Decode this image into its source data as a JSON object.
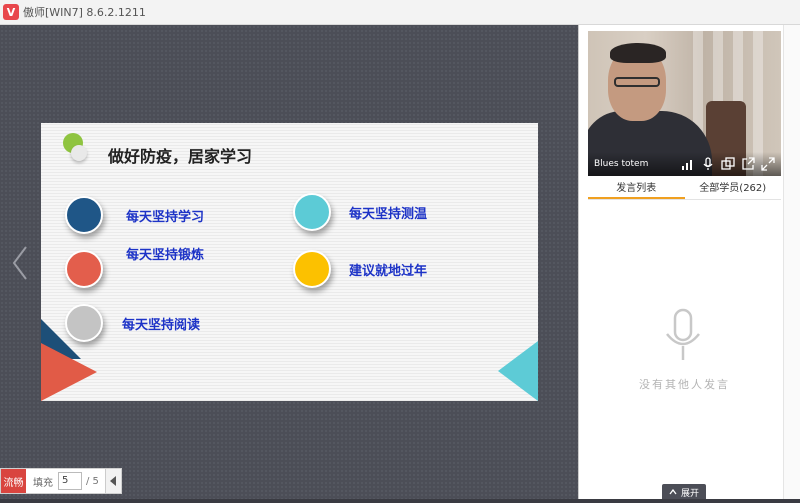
{
  "window": {
    "title": "傲师[WIN7] 8.6.2.1211",
    "logo_letter": "V"
  },
  "slide": {
    "title": "做好防疫，居家学习",
    "items": [
      {
        "label": "每天坚持学习",
        "color": "#1f5687"
      },
      {
        "label": "每天坚持锻炼",
        "color": "#e35e4c"
      },
      {
        "label": "每天坚持阅读",
        "color": "#c4c4c4"
      },
      {
        "label": "每天坚持测温",
        "color": "#5ccbd6"
      },
      {
        "label": "建议就地过年",
        "color": "#fcc100"
      }
    ]
  },
  "toolbar": {
    "quality_label": "流畅",
    "fill_label": "填充",
    "current_page": "5",
    "total_pages": "/ 5"
  },
  "video": {
    "name": "Blues totem"
  },
  "tabs": {
    "chat_list": "发言列表",
    "all_students": "全部学员(262)"
  },
  "empty_state": {
    "text": "没有其他人发言"
  },
  "expand": {
    "label": "展开"
  },
  "colors": {
    "accent": "#d9453f",
    "tab_active": "#f0a020"
  }
}
